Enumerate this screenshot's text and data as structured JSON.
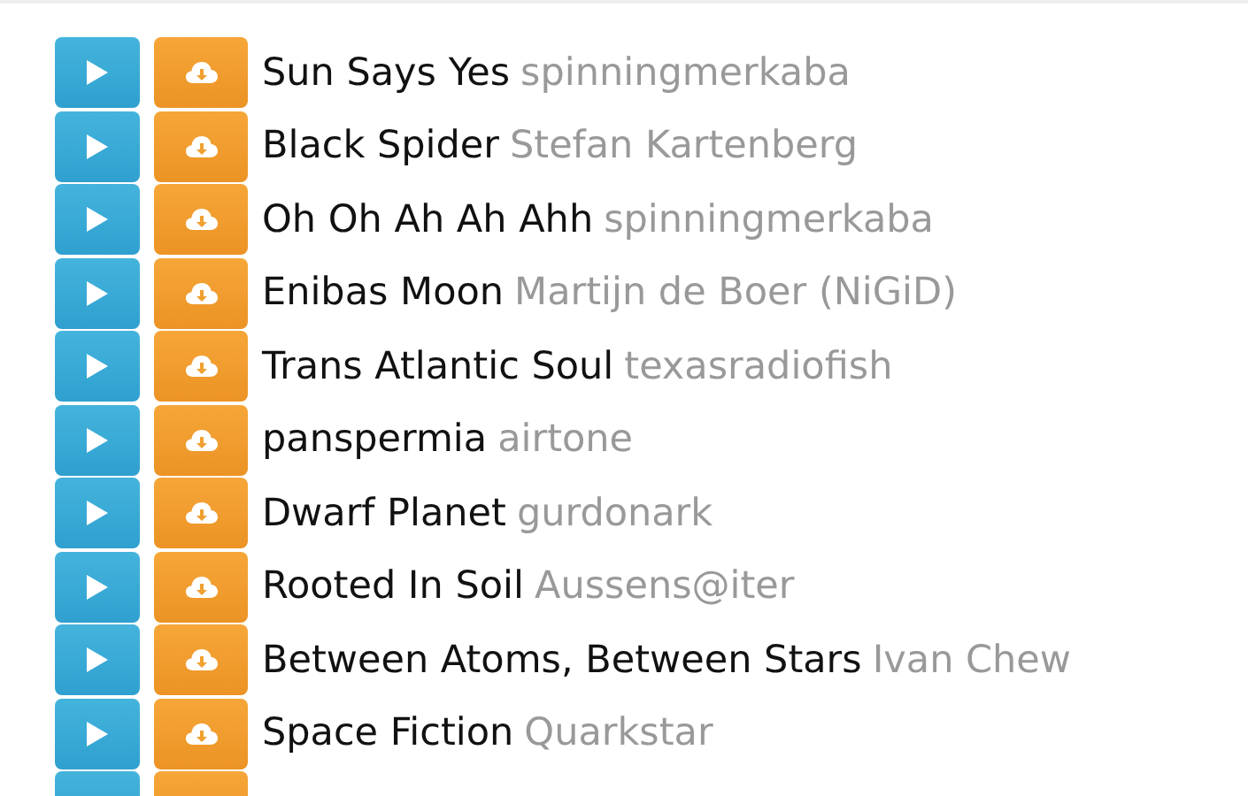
{
  "tracks": [
    {
      "title": "Sun Says Yes",
      "artist": "spinningmerkaba"
    },
    {
      "title": "Black Spider",
      "artist": "Stefan Kartenberg"
    },
    {
      "title": "Oh Oh Ah Ah Ahh",
      "artist": "spinningmerkaba"
    },
    {
      "title": "Enibas Moon",
      "artist": "Martijn de Boer (NiGiD)"
    },
    {
      "title": "Trans Atlantic Soul",
      "artist": "texasradiofish"
    },
    {
      "title": "panspermia",
      "artist": "airtone"
    },
    {
      "title": "Dwarf Planet",
      "artist": "gurdonark"
    },
    {
      "title": "Rooted In Soil",
      "artist": "Aussens@iter"
    },
    {
      "title": "Between Atoms, Between Stars",
      "artist": "Ivan Chew"
    },
    {
      "title": "Space Fiction",
      "artist": "Quarkstar"
    }
  ],
  "more_below": true
}
